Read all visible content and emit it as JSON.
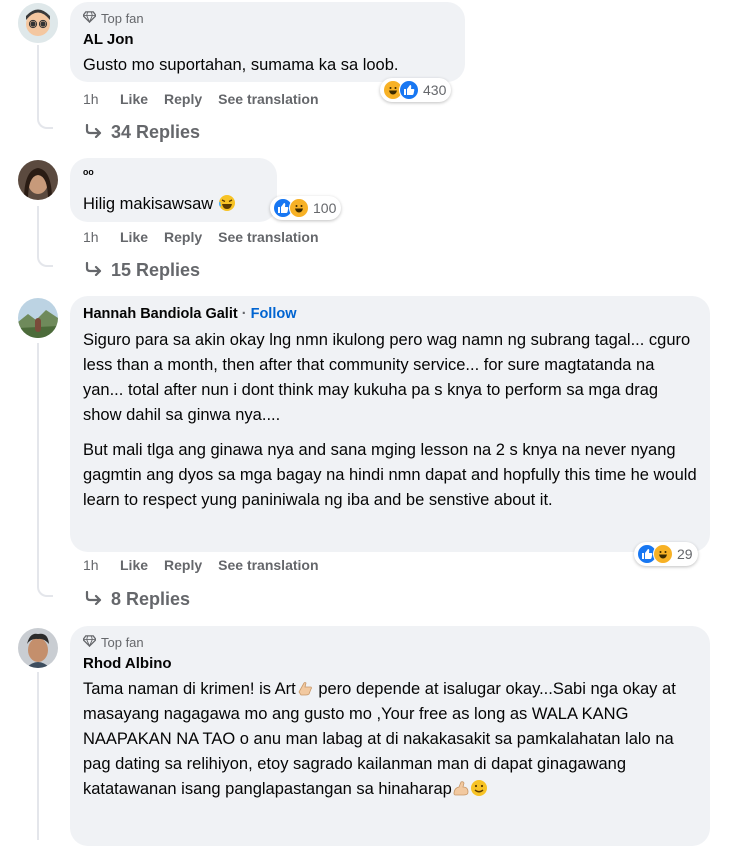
{
  "comments": [
    {
      "badge": "Top fan",
      "name": "AL Jon",
      "text": [
        "Gusto mo suportahan, sumama ka sa loob."
      ],
      "time": "1h",
      "like": "Like",
      "reply": "Reply",
      "translate": "See translation",
      "reaction_count": "430",
      "replies": "34 Replies"
    },
    {
      "name": "ᵒᵒ",
      "text": [
        "Hilig makisawsaw"
      ],
      "time": "1h",
      "like": "Like",
      "reply": "Reply",
      "translate": "See translation",
      "reaction_count": "100",
      "replies": "15 Replies"
    },
    {
      "name": "Hannah Bandiola Galit",
      "follow": "Follow",
      "dot": "·",
      "text": [
        "Siguro para sa akin okay lng nmn ikulong pero wag namn ng subrang tagal... cguro less than a month, then after that community service... for sure magtatanda na yan... total after nun i dont think may kukuha pa s knya to perform sa mga drag show dahil sa ginwa nya....",
        "But mali tlga ang ginawa nya and sana mging lesson na 2 s knya na never nyang gagmtin ang dyos sa mga bagay na hindi nmn dapat and hopfully this time he would learn to respect yung paniniwala ng iba and be senstive about it."
      ],
      "time": "1h",
      "like": "Like",
      "reply": "Reply",
      "translate": "See translation",
      "reaction_count": "29",
      "replies": "8 Replies"
    },
    {
      "badge": "Top fan",
      "name": "Rhod Albino",
      "text": [
        "Tama naman di krimen! is Art",
        " pero depende at isalugar okay...Sabi nga okay at masayang nagagawa mo ang gusto mo ,Your free as long as WALA KANG NAAPAKAN NA TAO o anu man labag at di nakakasakit sa pamkalahatan lalo na pag dating sa relihiyon, etoy sagrado kailanman man di dapat ginagawang katatawanan isang panglapastangan sa hinaharap"
      ]
    }
  ],
  "colors": {
    "bubble": "#f0f2f5",
    "meta": "#65676b",
    "like": "#1877f2",
    "haha": "#f7b125",
    "follow": "#0064d1"
  },
  "icons": [
    "diamond-icon",
    "reply-arrow-icon",
    "like-reaction-icon",
    "haha-reaction-icon",
    "laughing-emoji-icon",
    "hand-emoji-icon",
    "muscle-emoji-icon",
    "smile-emoji-icon"
  ]
}
